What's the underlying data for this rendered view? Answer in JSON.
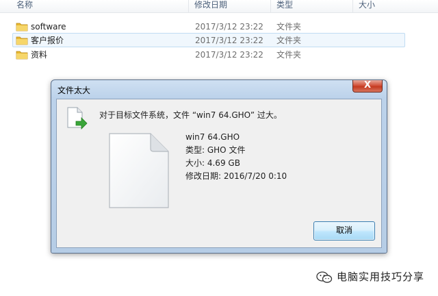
{
  "explorer": {
    "columns": {
      "name": "名称",
      "date": "修改日期",
      "type": "类型",
      "size": "大小"
    },
    "rows": [
      {
        "name": "software",
        "date": "2017/3/12 23:22",
        "type": "文件夹",
        "selected": false
      },
      {
        "name": "客户报价",
        "date": "2017/3/12 23:22",
        "type": "文件夹",
        "selected": true
      },
      {
        "name": "资料",
        "date": "2017/3/12 23:22",
        "type": "文件夹",
        "selected": false
      }
    ]
  },
  "dialog": {
    "title": "文件太大",
    "message": "对于目标文件系统，文件 “win7 64.GHO” 过大。",
    "file": {
      "name": "win7 64.GHO",
      "type": "类型: GHO 文件",
      "size": "大小: 4.69 GB",
      "modified": "修改日期: 2016/7/20 0:10"
    },
    "cancel_label": "取消",
    "close_symbol": "X"
  },
  "watermark": {
    "text": "电脑实用技巧分享",
    "icon": "wechat-icon"
  },
  "colors": {
    "folder": "#e8b830",
    "accent": "#3c7fb1",
    "close": "#c43a20",
    "arrow": "#3aa53a"
  }
}
